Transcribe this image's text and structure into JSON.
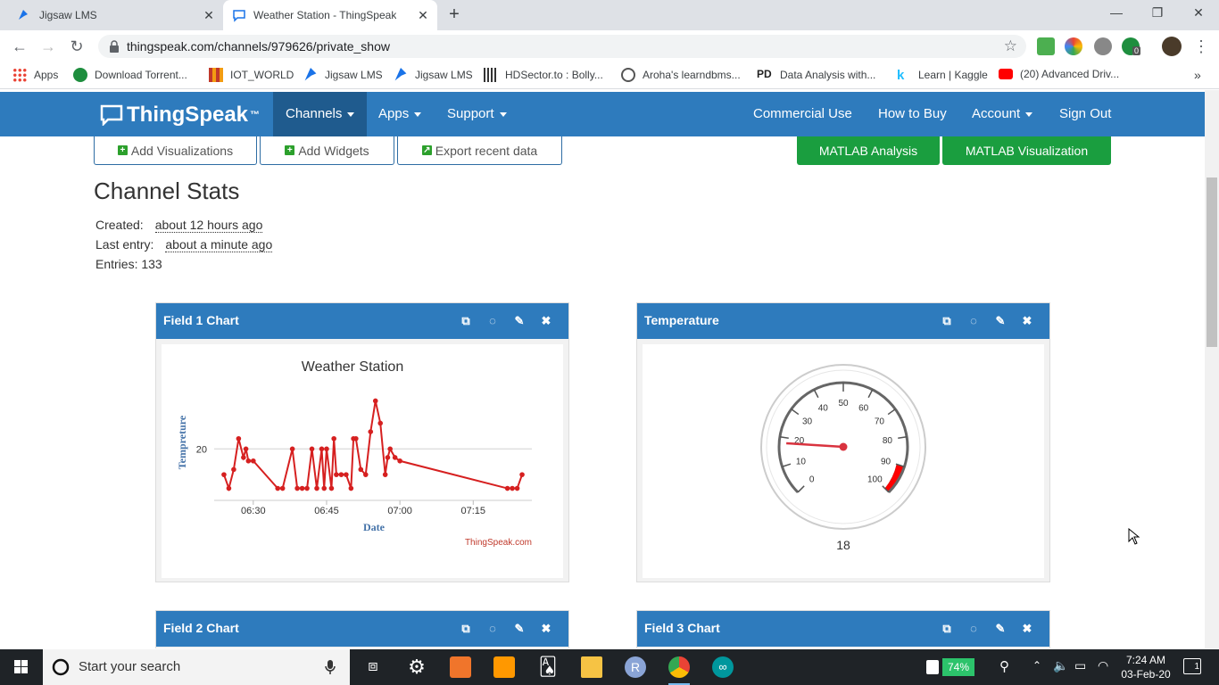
{
  "browser": {
    "tabs": [
      {
        "label": "Jigsaw LMS"
      },
      {
        "label": "Weather Station - ThingSpeak Io"
      }
    ],
    "url": "thingspeak.com/channels/979626/private_show",
    "ext_badge": "0",
    "bookmarks": [
      "Apps",
      "Download Torrent...",
      "IOT_WORLD",
      "Jigsaw LMS",
      "Jigsaw LMS",
      "HDSector.to : Bolly...",
      "Aroha's learndbms...",
      "Data Analysis with...",
      "Learn | Kaggle",
      "(20) Advanced Driv..."
    ]
  },
  "nav": {
    "logo": "ThingSpeak",
    "logo_tm": "™",
    "channels": "Channels",
    "apps": "Apps",
    "support": "Support",
    "commercial": "Commercial Use",
    "how_to_buy": "How to Buy",
    "account": "Account",
    "sign_out": "Sign Out"
  },
  "actions": {
    "add_viz": "Add Visualizations",
    "add_widgets": "Add Widgets",
    "export": "Export recent data",
    "matlab_analysis": "MATLAB Analysis",
    "matlab_viz": "MATLAB Visualization"
  },
  "stats": {
    "title": "Channel Stats",
    "created_label": "Created:",
    "created_value": "about 12 hours ago",
    "last_label": "Last entry:",
    "last_value": "about a minute ago",
    "entries": "Entries: 133"
  },
  "widgets": {
    "w1_title": "Field 1 Chart",
    "w2_title": "Temperature",
    "w3_title": "Field 2 Chart",
    "w4_title": "Field 3 Chart",
    "gauge_value": "18",
    "chart_credit": "ThingSpeak.com"
  },
  "chart_data": [
    {
      "type": "line",
      "title": "Weather Station",
      "xlabel": "Date",
      "ylabel": "Tempreture",
      "x_ticks": [
        "06:30",
        "06:45",
        "07:00",
        "07:15"
      ],
      "y_ticks": [
        20
      ],
      "color": "#d62020",
      "series": [
        {
          "values_minutes_label": "time",
          "points": [
            [
              "06:24",
              18.5
            ],
            [
              "06:25",
              17.7
            ],
            [
              "06:26",
              18.8
            ],
            [
              "06:27",
              20.6
            ],
            [
              "06:28",
              19.5
            ],
            [
              "06:28:30",
              20.0
            ],
            [
              "06:29",
              19.3
            ],
            [
              "06:30",
              19.3
            ],
            [
              "06:35",
              17.7
            ],
            [
              "06:36",
              17.7
            ],
            [
              "06:38",
              20.0
            ],
            [
              "06:39",
              17.7
            ],
            [
              "06:40",
              17.7
            ],
            [
              "06:41",
              17.7
            ],
            [
              "06:42",
              20.0
            ],
            [
              "06:43",
              17.7
            ],
            [
              "06:44",
              20.0
            ],
            [
              "06:44:30",
              17.7
            ],
            [
              "06:45",
              20.0
            ],
            [
              "06:46",
              17.7
            ],
            [
              "06:46:30",
              20.6
            ],
            [
              "06:47",
              18.5
            ],
            [
              "06:48",
              18.5
            ],
            [
              "06:49",
              18.5
            ],
            [
              "06:50",
              17.7
            ],
            [
              "06:50:30",
              20.6
            ],
            [
              "06:51",
              20.6
            ],
            [
              "06:52",
              18.8
            ],
            [
              "06:53",
              18.5
            ],
            [
              "06:54",
              21.0
            ],
            [
              "06:55",
              22.8
            ],
            [
              "06:56",
              21.5
            ],
            [
              "06:57",
              18.5
            ],
            [
              "06:57:30",
              19.5
            ],
            [
              "06:58",
              20.0
            ],
            [
              "06:59",
              19.5
            ],
            [
              "07:00",
              19.3
            ],
            [
              "07:22",
              17.7
            ],
            [
              "07:23",
              17.7
            ],
            [
              "07:24",
              17.7
            ],
            [
              "07:25",
              18.5
            ]
          ]
        }
      ]
    },
    {
      "type": "gauge",
      "title": "Temperature",
      "min": 0,
      "max": 100,
      "ticks": [
        0,
        10,
        20,
        30,
        40,
        50,
        60,
        70,
        80,
        90,
        100
      ],
      "value": 18,
      "danger_band": [
        90,
        100
      ]
    }
  ],
  "taskbar": {
    "search_placeholder": "Start your search",
    "battery": "74%",
    "time": "7:24 AM",
    "date": "03-Feb-20",
    "notif": "1"
  }
}
